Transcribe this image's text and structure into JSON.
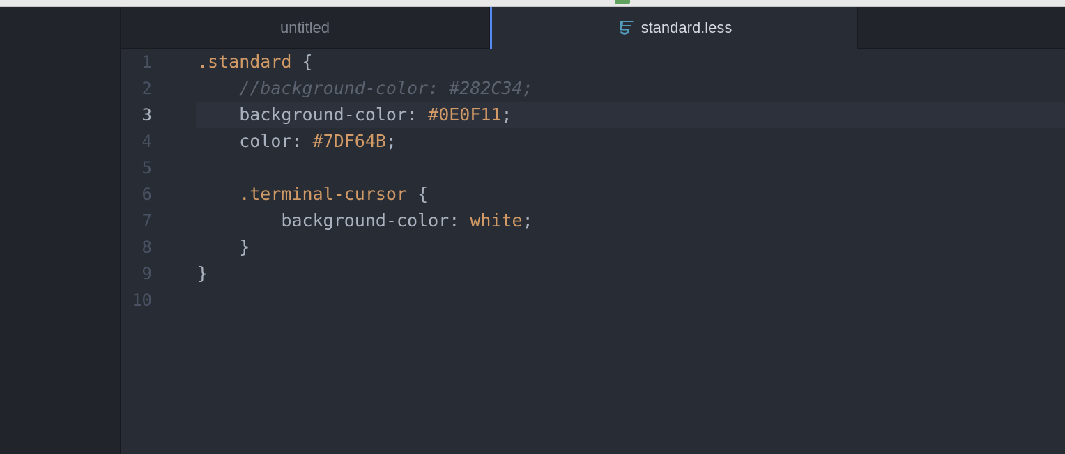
{
  "tabs": [
    {
      "label": "untitled",
      "active": false
    },
    {
      "label": "standard.less",
      "active": true,
      "icon": "css3-icon"
    }
  ],
  "editor": {
    "cursor_line": 3,
    "lines": [
      {
        "num": "1",
        "tokens": [
          {
            "t": ".standard",
            "c": "selector"
          },
          {
            "t": " {",
            "c": "punct"
          }
        ]
      },
      {
        "num": "2",
        "tokens": [
          {
            "t": "    //background-color: #282C34;",
            "c": "comment"
          }
        ]
      },
      {
        "num": "3",
        "tokens": [
          {
            "t": "    background-color: ",
            "c": "prop"
          },
          {
            "t": "#0E0F11",
            "c": "value"
          },
          {
            "t": ";",
            "c": "punct"
          }
        ]
      },
      {
        "num": "4",
        "tokens": [
          {
            "t": "    color: ",
            "c": "prop"
          },
          {
            "t": "#7DF64B",
            "c": "value"
          },
          {
            "t": ";",
            "c": "punct"
          }
        ]
      },
      {
        "num": "5",
        "tokens": []
      },
      {
        "num": "6",
        "tokens": [
          {
            "t": "    .terminal-cursor",
            "c": "selector"
          },
          {
            "t": " {",
            "c": "punct"
          }
        ]
      },
      {
        "num": "7",
        "tokens": [
          {
            "t": "        background-color: ",
            "c": "prop"
          },
          {
            "t": "white",
            "c": "value"
          },
          {
            "t": ";",
            "c": "punct"
          }
        ]
      },
      {
        "num": "8",
        "tokens": [
          {
            "t": "    }",
            "c": "punct"
          }
        ]
      },
      {
        "num": "9",
        "tokens": [
          {
            "t": "}",
            "c": "punct"
          }
        ]
      },
      {
        "num": "10",
        "tokens": []
      }
    ]
  },
  "colors": {
    "background": "#282c34",
    "accent": "#568af2",
    "selector": "#d19a66",
    "comment": "#5c6370",
    "text": "#abb2bf"
  }
}
